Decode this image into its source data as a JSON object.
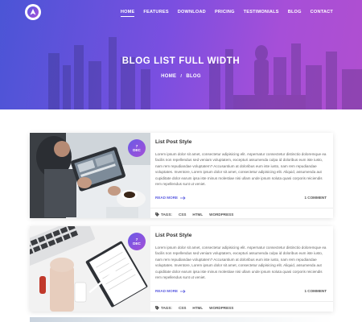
{
  "nav": {
    "items": [
      "HOME",
      "FEATURES",
      "DOWNLOAD",
      "PRICING",
      "TESTIMONIALS",
      "BLOG",
      "CONTACT"
    ],
    "active_index": 0
  },
  "hero": {
    "title": "BLOG LIST FULL WIDTH",
    "breadcrumb_home": "HOME",
    "breadcrumb_sep": "/",
    "breadcrumb_current": "BLOG"
  },
  "posts": [
    {
      "day": "7",
      "month": "DEC",
      "title": "List Post Style",
      "excerpt": "Lorem ipsum dolor sit amet, consectetur adipisicing elit. Aspernatur consectetur distinctio doloremque ea facilis non repellendus sed veniam voluptatem, excepturi assumenda culpa id doloribus eum iste iusto, nam rem repudiandae voluptatem? Accusantium at doloribus eum iste iusto, nam rem repudiandae voluptates. Inventore, Lorem ipsum dolor sit amet, consectetur adipisicing elit. Aliquid, assumenda aut cupiditate dolor earum ipsa iste minus molestiae nisi ullam unde ipsum soluta quasi corporis reiciendis rem repellendus sunt ut veniet.",
      "read_more": "READ MORE",
      "comments": "1 COMMENT",
      "tags_label": "TAGS:",
      "tags": [
        "CSS",
        "HTML",
        "WORDPRESS"
      ]
    },
    {
      "day": "7",
      "month": "DEC",
      "title": "List Post Style",
      "excerpt": "Lorem ipsum dolor sit amet, consectetur adipisicing elit. Aspernatur consectetur distinctio doloremque ea facilis non repellendus sed veniam voluptatem, excepturi assumenda culpa id doloribus eum iste iusto, nam rem repudiandae voluptatem? Accusantium at doloribus eum iste iusto, nam rem repudiandae voluptates. Inventore, Lorem ipsum dolor sit amet, consectetur adipisicing elit. Aliquid, assumenda aut cupiditate dolor earum ipsa iste minus molestiae nisi ullam unde ipsum soluta quasi corporis reiciendis rem repellendus sunt ut veniet.",
      "read_more": "READ MORE",
      "comments": "1 COMMENT",
      "tags_label": "TAGS:",
      "tags": [
        "CSS",
        "HTML",
        "WORDPRESS"
      ]
    }
  ],
  "colors": {
    "gradient_start": "#4b55d6",
    "gradient_end": "#b04fd0",
    "accent": "#5b5ce0"
  },
  "icons": [
    "logo-icon",
    "arrow-right-icon",
    "tag-icon"
  ]
}
